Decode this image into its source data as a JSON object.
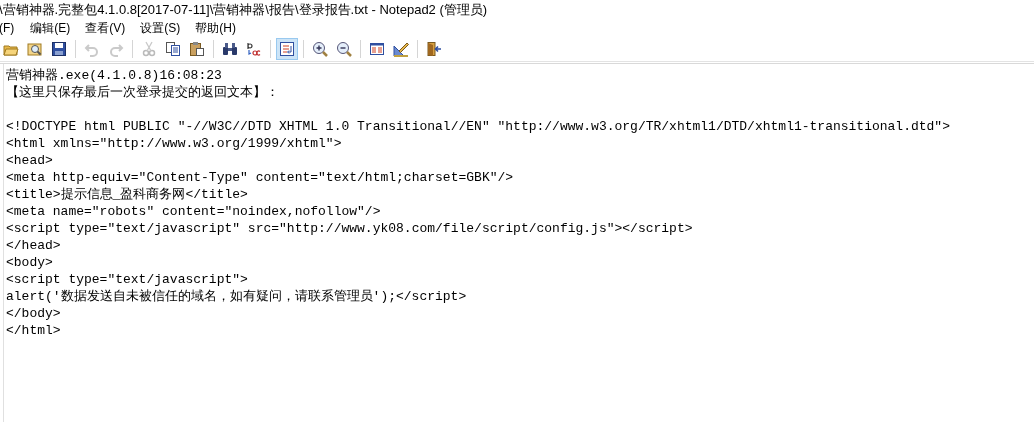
{
  "window": {
    "title": "\\营销神器.完整包4.1.0.8[2017-07-11]\\营销神器\\报告\\登录报告.txt - Notepad2 (管理员)"
  },
  "menu": [
    {
      "label": "(F)"
    },
    {
      "label": "编辑(E)"
    },
    {
      "label": "查看(V)"
    },
    {
      "label": "设置(S)"
    },
    {
      "label": "帮助(H)"
    }
  ],
  "toolbar": [
    {
      "kind": "button",
      "disabled": false,
      "selected": false
    },
    {
      "kind": "button",
      "disabled": false,
      "selected": false
    },
    {
      "kind": "button",
      "disabled": false,
      "selected": false
    },
    {
      "kind": "separator"
    },
    {
      "kind": "button",
      "disabled": true,
      "selected": false
    },
    {
      "kind": "button",
      "disabled": true,
      "selected": false
    },
    {
      "kind": "separator"
    },
    {
      "kind": "button",
      "disabled": true,
      "selected": false
    },
    {
      "kind": "button",
      "disabled": false,
      "selected": false
    },
    {
      "kind": "button",
      "disabled": false,
      "selected": false
    },
    {
      "kind": "separator"
    },
    {
      "kind": "button",
      "disabled": false,
      "selected": false
    },
    {
      "kind": "button",
      "disabled": false,
      "selected": false
    },
    {
      "kind": "separator"
    },
    {
      "kind": "button",
      "disabled": false,
      "selected": true
    },
    {
      "kind": "separator"
    },
    {
      "kind": "button",
      "disabled": false,
      "selected": false
    },
    {
      "kind": "button",
      "disabled": false,
      "selected": false
    },
    {
      "kind": "separator"
    },
    {
      "kind": "button",
      "disabled": false,
      "selected": false
    },
    {
      "kind": "button",
      "disabled": false,
      "selected": false
    },
    {
      "kind": "separator"
    },
    {
      "kind": "button",
      "disabled": false,
      "selected": false
    }
  ],
  "editor": {
    "header_lines": [
      "营销神器.exe(4.1.0.8)16:08:23",
      "【这里只保存最后一次登录提交的返回文本】："
    ],
    "lines": [
      "<!DOCTYPE html PUBLIC \"-//W3C//DTD XHTML 1.0 Transitional//EN\" \"http://www.w3.org/TR/xhtml1/DTD/xhtml1-transitional.dtd\">",
      "<html xmlns=\"http://www.w3.org/1999/xhtml\">",
      "<head>",
      "<meta http-equiv=\"Content-Type\" content=\"text/html;charset=GBK\"/>",
      "<title>提示信息_盈科商务网</title>",
      "<meta name=\"robots\" content=\"noindex,nofollow\"/>",
      "<script type=\"text/javascript\" src=\"http://www.yk08.com/file/script/config.js\"></script>",
      "</head>",
      "<body>",
      "<script type=\"text/javascript\">",
      "alert('数据发送自未被信任的域名，如有疑问，请联系管理员');</script>",
      "</body>",
      "</html>"
    ]
  }
}
